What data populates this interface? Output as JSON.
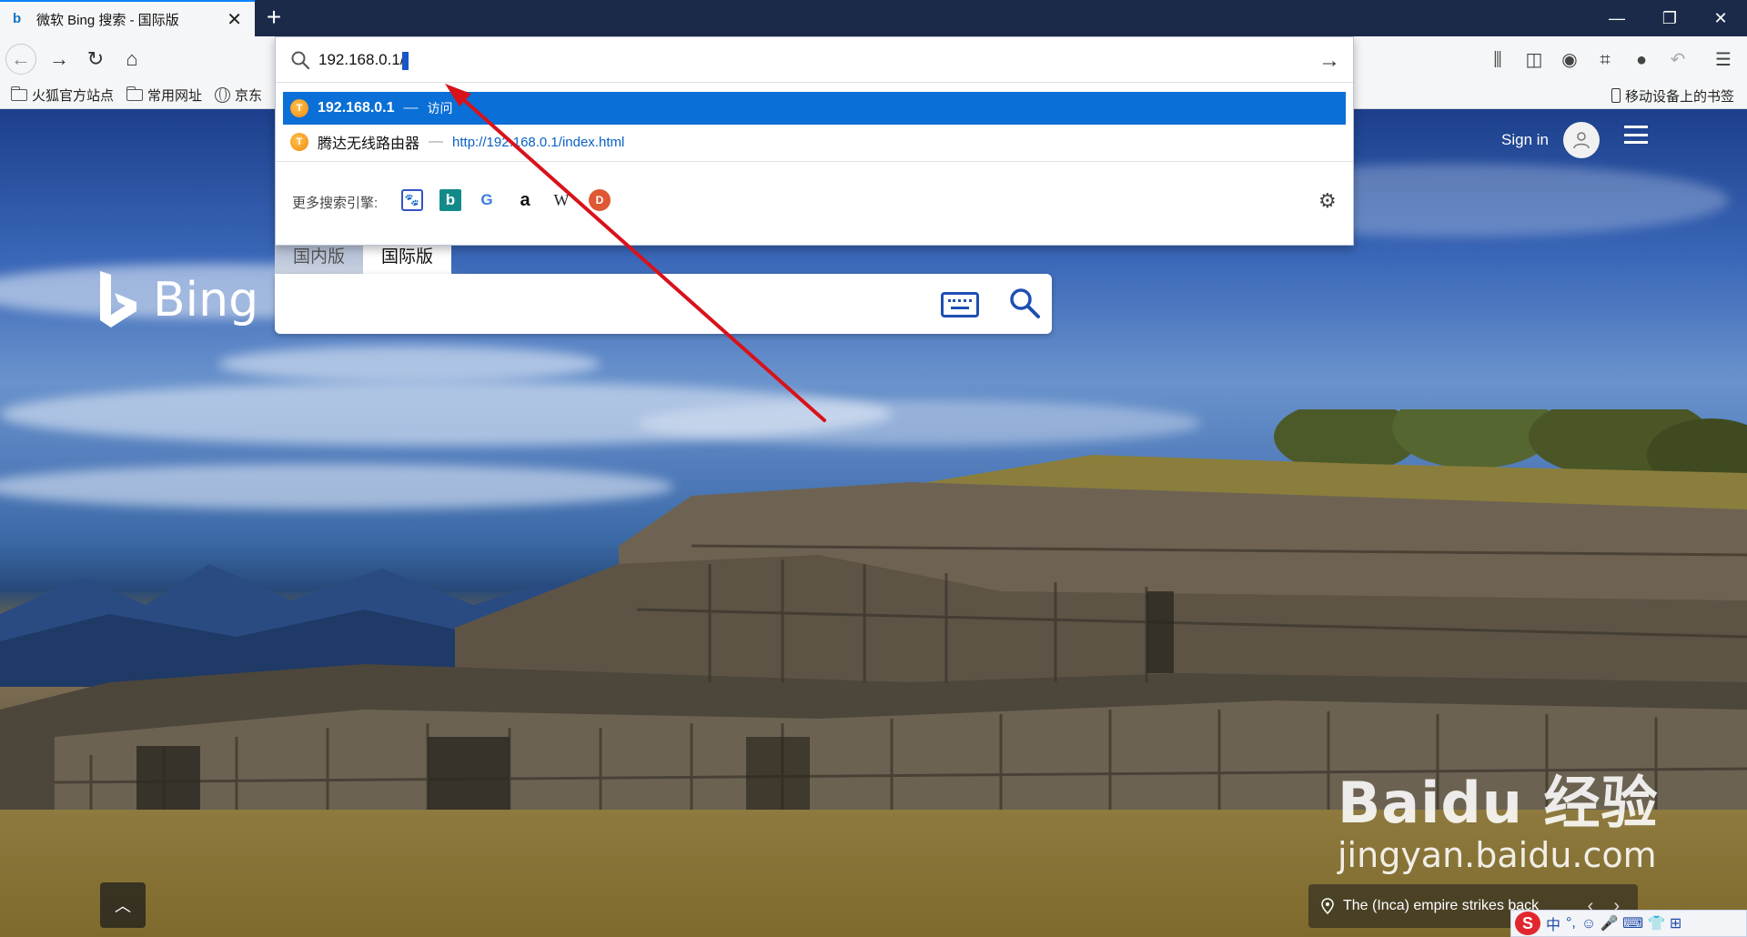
{
  "browser": {
    "tab": {
      "title": "微软 Bing 搜索 - 国际版",
      "favicon": "b"
    },
    "new_tab": "+",
    "window_controls": {
      "minimize": "—",
      "restore": "❐",
      "close": "✕"
    }
  },
  "bookmarks": {
    "items": [
      {
        "label": "火狐官方站点",
        "icon": "folder-icon"
      },
      {
        "label": "常用网址",
        "icon": "folder-icon"
      },
      {
        "label": "京东",
        "icon": "globe-icon"
      }
    ],
    "mobile": "移动设备上的书签"
  },
  "urlbar": {
    "value": "192.168.0.1/",
    "results": [
      {
        "title": "192.168.0.1",
        "separator": "—",
        "action": "访问",
        "selected": true
      },
      {
        "title": "腾达无线路由器",
        "separator": "—",
        "url": "http://192.168.0.1/index.html",
        "selected": false
      }
    ],
    "engines_label": "更多搜索引擎:",
    "engines": [
      "baidu-icon",
      "bing-icon",
      "google-icon",
      "amazon-icon",
      "wikipedia-icon",
      "duckduckgo-icon"
    ]
  },
  "bing": {
    "logo_text": "Bing",
    "scope_tabs": [
      "国内版",
      "国际版"
    ],
    "active_scope": "国际版",
    "sign_in": "Sign in",
    "caption": "The (Inca) empire strikes back",
    "caption_prev": "‹",
    "caption_next": "›",
    "scroll_top": "︿"
  },
  "watermark": {
    "main": "Baidu 经验",
    "sub": "jingyan.baidu.com"
  },
  "ime": {
    "logo": "S",
    "mode": "中",
    "punct": "°,",
    "items": "☺ 🎤 ⌨ 👕 ⊞"
  },
  "colors": {
    "accent": "#0a6fd6",
    "titlebar": "#1c2a4a",
    "arrow": "#d8121b",
    "bing_blue": "#1e4fb2"
  }
}
